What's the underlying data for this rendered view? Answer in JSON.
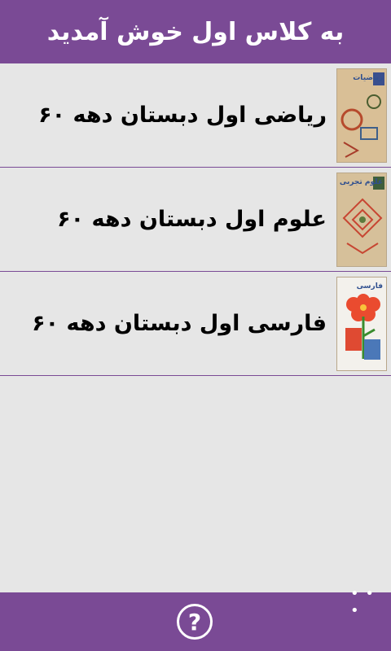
{
  "header": {
    "title": "به کلاس اول خوش آمدید"
  },
  "books": [
    {
      "title": "ریاضی اول دبستان دهه ۶۰",
      "cover_label": "ریاضیات",
      "cover_icon": "math-book-cover-icon"
    },
    {
      "title": "علوم اول دبستان دهه ۶۰",
      "cover_label": "علوم تجربی",
      "cover_icon": "science-book-cover-icon"
    },
    {
      "title": "فارسی اول دبستان دهه ۶۰",
      "cover_label": "فارسی",
      "cover_icon": "persian-book-cover-icon"
    }
  ],
  "app_bar": {
    "help_icon": "?",
    "more_icon": "• • •"
  },
  "colors": {
    "accent": "#7a4a95",
    "background": "#e6e6e6",
    "text": "#000000"
  }
}
